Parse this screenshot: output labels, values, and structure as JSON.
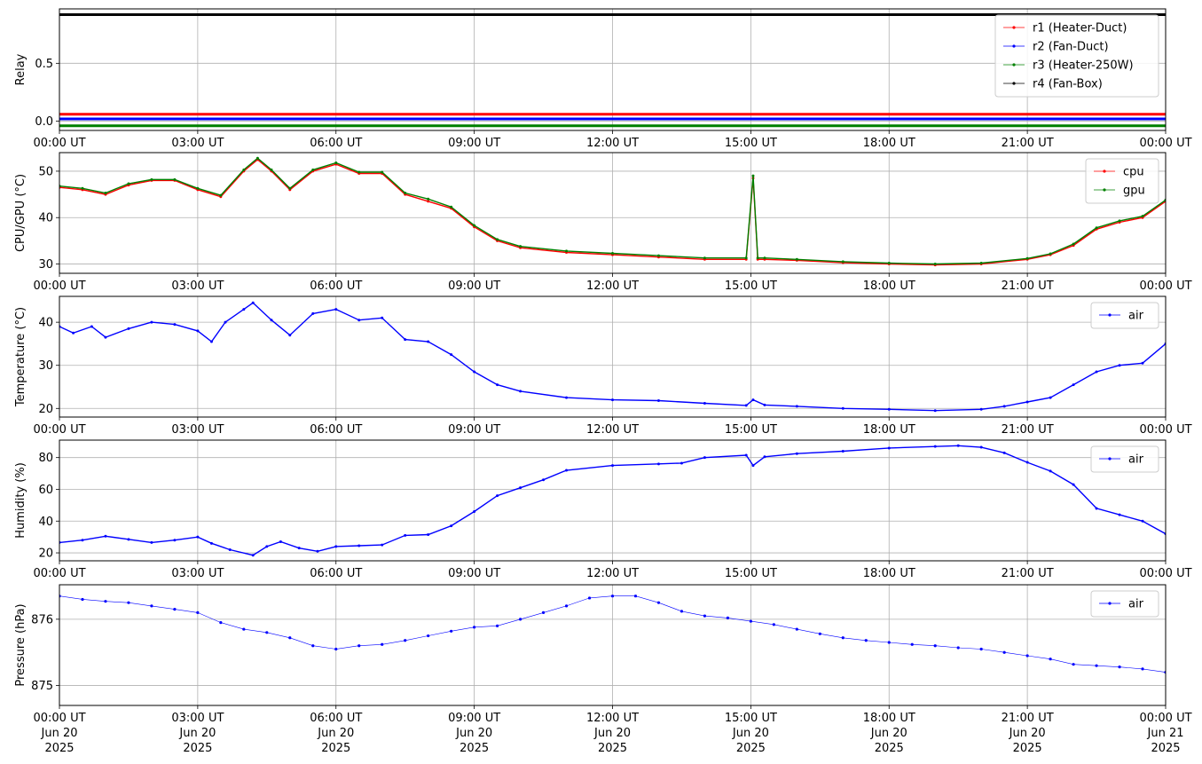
{
  "x_ticks": [
    "00:00 UT",
    "03:00 UT",
    "06:00 UT",
    "09:00 UT",
    "12:00 UT",
    "15:00 UT",
    "18:00 UT",
    "21:00 UT",
    "00:00 UT"
  ],
  "x_date_lines": [
    [
      "Jun 20",
      "2025"
    ],
    [
      "Jun 20",
      "2025"
    ],
    [
      "Jun 20",
      "2025"
    ],
    [
      "Jun 20",
      "2025"
    ],
    [
      "Jun 20",
      "2025"
    ],
    [
      "Jun 20",
      "2025"
    ],
    [
      "Jun 20",
      "2025"
    ],
    [
      "Jun 20",
      "2025"
    ],
    [
      "Jun 21",
      "2025"
    ]
  ],
  "chart_data": [
    {
      "type": "line",
      "ylabel": "Relay",
      "xlim": [
        0,
        24
      ],
      "ylim": [
        -0.08,
        0.97
      ],
      "yticks": [
        0.0,
        0.5
      ],
      "ytick_labels": [
        "0.0",
        "0.5"
      ],
      "grid": true,
      "legend_position": "top-right",
      "series": [
        {
          "name": "r1 (Heater-Duct)",
          "color": "#ff0000",
          "x": [
            0,
            24
          ],
          "y": [
            0.06,
            0.06
          ]
        },
        {
          "name": "r2 (Fan-Duct)",
          "color": "#0000ff",
          "x": [
            0,
            24
          ],
          "y": [
            0.02,
            0.02
          ]
        },
        {
          "name": "r3 (Heater-250W)",
          "color": "#008000",
          "x": [
            0,
            24
          ],
          "y": [
            -0.04,
            -0.04
          ]
        },
        {
          "name": "r4 (Fan-Box)",
          "color": "#000000",
          "x": [
            0,
            24
          ],
          "y": [
            0.92,
            0.92
          ]
        }
      ]
    },
    {
      "type": "line",
      "ylabel": "CPU/GPU (°C)",
      "xlim": [
        0,
        24
      ],
      "ylim": [
        28,
        54
      ],
      "yticks": [
        30,
        40,
        50
      ],
      "ytick_labels": [
        "30",
        "40",
        "50"
      ],
      "grid": true,
      "legend_position": "top-right",
      "series": [
        {
          "name": "cpu",
          "color": "#ff0000",
          "x": [
            0,
            0.5,
            1.0,
            1.5,
            2.0,
            2.5,
            3.0,
            3.5,
            4.0,
            4.3,
            4.6,
            5.0,
            5.5,
            6.0,
            6.5,
            7.0,
            7.5,
            8.0,
            8.5,
            9.0,
            9.5,
            10.0,
            11.0,
            12.0,
            13.0,
            14.0,
            14.9,
            15.05,
            15.15,
            15.3,
            16.0,
            17.0,
            18.0,
            19.0,
            20.0,
            21.0,
            21.5,
            22.0,
            22.5,
            23.0,
            23.5,
            24.0
          ],
          "y": [
            46.5,
            46.0,
            45.0,
            47.0,
            48.0,
            48.0,
            46.0,
            44.5,
            50.0,
            52.5,
            50.0,
            46.0,
            50.0,
            51.5,
            49.5,
            49.5,
            45.0,
            43.5,
            42.0,
            38.0,
            35.0,
            33.5,
            32.5,
            32.0,
            31.5,
            31.0,
            31.0,
            48.5,
            31.0,
            31.0,
            30.8,
            30.3,
            30.0,
            29.8,
            30.0,
            31.0,
            32.0,
            34.0,
            37.5,
            39.0,
            40.0,
            43.5
          ]
        },
        {
          "name": "gpu",
          "color": "#008000",
          "x": [
            0,
            0.5,
            1.0,
            1.5,
            2.0,
            2.5,
            3.0,
            3.5,
            4.0,
            4.3,
            4.6,
            5.0,
            5.5,
            6.0,
            6.5,
            7.0,
            7.5,
            8.0,
            8.5,
            9.0,
            9.5,
            10.0,
            11.0,
            12.0,
            13.0,
            14.0,
            14.9,
            15.05,
            15.15,
            15.3,
            16.0,
            17.0,
            18.0,
            19.0,
            20.0,
            21.0,
            21.5,
            22.0,
            22.5,
            23.0,
            23.5,
            24.0
          ],
          "y": [
            46.8,
            46.3,
            45.3,
            47.3,
            48.2,
            48.2,
            46.3,
            44.8,
            50.3,
            52.8,
            50.3,
            46.3,
            50.3,
            51.8,
            49.8,
            49.8,
            45.3,
            44.0,
            42.3,
            38.3,
            35.3,
            33.8,
            32.8,
            32.3,
            31.8,
            31.3,
            31.3,
            49.0,
            31.3,
            31.3,
            31.0,
            30.5,
            30.2,
            30.0,
            30.2,
            31.2,
            32.2,
            34.3,
            37.8,
            39.3,
            40.3,
            43.8
          ]
        }
      ]
    },
    {
      "type": "line",
      "ylabel": "Temperature (°C)",
      "xlim": [
        0,
        24
      ],
      "ylim": [
        18,
        46
      ],
      "yticks": [
        20,
        30,
        40
      ],
      "ytick_labels": [
        "20",
        "30",
        "40"
      ],
      "grid": true,
      "legend_position": "top-right",
      "series": [
        {
          "name": "air",
          "color": "#0000ff",
          "x": [
            0,
            0.3,
            0.7,
            1.0,
            1.5,
            2.0,
            2.5,
            3.0,
            3.3,
            3.6,
            4.0,
            4.2,
            4.6,
            5.0,
            5.5,
            6.0,
            6.5,
            7.0,
            7.5,
            8.0,
            8.5,
            9.0,
            9.5,
            10.0,
            11.0,
            12.0,
            13.0,
            14.0,
            14.9,
            15.05,
            15.3,
            16.0,
            17.0,
            18.0,
            19.0,
            20.0,
            20.5,
            21.0,
            21.5,
            22.0,
            22.5,
            23.0,
            23.5,
            24.0
          ],
          "y": [
            39.0,
            37.5,
            39.0,
            36.5,
            38.5,
            40.0,
            39.5,
            38.0,
            35.5,
            40.0,
            43.0,
            44.5,
            40.5,
            37.0,
            42.0,
            43.0,
            40.5,
            41.0,
            36.0,
            35.5,
            32.5,
            28.5,
            25.5,
            24.0,
            22.5,
            22.0,
            21.8,
            21.2,
            20.7,
            22.0,
            20.8,
            20.5,
            20.0,
            19.8,
            19.5,
            19.8,
            20.5,
            21.5,
            22.5,
            25.5,
            28.5,
            30.0,
            30.5,
            35.0
          ]
        }
      ]
    },
    {
      "type": "line",
      "ylabel": "Humidity (%)",
      "xlim": [
        0,
        24
      ],
      "ylim": [
        15,
        91
      ],
      "yticks": [
        20,
        40,
        60,
        80
      ],
      "ytick_labels": [
        "20",
        "40",
        "60",
        "80"
      ],
      "grid": true,
      "legend_position": "top-right",
      "series": [
        {
          "name": "air",
          "color": "#0000ff",
          "x": [
            0,
            0.5,
            1.0,
            1.5,
            2.0,
            2.5,
            3.0,
            3.3,
            3.7,
            4.2,
            4.5,
            4.8,
            5.2,
            5.6,
            6.0,
            6.5,
            7.0,
            7.5,
            8.0,
            8.5,
            9.0,
            9.5,
            10.0,
            10.5,
            11.0,
            12.0,
            13.0,
            13.5,
            14.0,
            14.9,
            15.05,
            15.3,
            16.0,
            17.0,
            18.0,
            19.0,
            19.5,
            20.0,
            20.5,
            21.0,
            21.5,
            22.0,
            22.5,
            23.0,
            23.5,
            24.0
          ],
          "y": [
            26.5,
            28.0,
            30.5,
            28.5,
            26.5,
            28.0,
            30.0,
            26.0,
            22.0,
            18.5,
            24.0,
            27.0,
            23.0,
            21.0,
            24.0,
            24.5,
            25.0,
            31.0,
            31.5,
            37.0,
            46.0,
            56.0,
            61.0,
            66.0,
            72.0,
            75.0,
            76.0,
            76.5,
            80.0,
            81.5,
            75.0,
            80.5,
            82.5,
            84.0,
            86.0,
            87.0,
            87.5,
            86.5,
            83.0,
            77.0,
            71.5,
            63.0,
            48.0,
            44.0,
            40.0,
            32.0
          ]
        }
      ]
    },
    {
      "type": "scatter",
      "ylabel": "Pressure (hPa)",
      "xlim": [
        0,
        24
      ],
      "ylim": [
        874.7,
        876.52
      ],
      "yticks": [
        875,
        876
      ],
      "ytick_labels": [
        "875",
        "876"
      ],
      "grid": true,
      "legend_position": "top-right",
      "series": [
        {
          "name": "air",
          "color": "#0000ff",
          "x": [
            0,
            0.5,
            1.0,
            1.5,
            2.0,
            2.5,
            3.0,
            3.5,
            4.0,
            4.5,
            5.0,
            5.5,
            6.0,
            6.5,
            7.0,
            7.5,
            8.0,
            8.5,
            9.0,
            9.5,
            10.0,
            10.5,
            11.0,
            11.5,
            12.0,
            12.5,
            13.0,
            13.5,
            14.0,
            14.5,
            15.0,
            15.5,
            16.0,
            16.5,
            17.0,
            17.5,
            18.0,
            18.5,
            19.0,
            19.5,
            20.0,
            20.5,
            21.0,
            21.5,
            22.0,
            22.5,
            23.0,
            23.5,
            24.0
          ],
          "y": [
            876.35,
            876.3,
            876.27,
            876.25,
            876.2,
            876.15,
            876.1,
            875.95,
            875.85,
            875.8,
            875.72,
            875.6,
            875.55,
            875.6,
            875.62,
            875.68,
            875.75,
            875.82,
            875.88,
            875.9,
            876.0,
            876.1,
            876.2,
            876.32,
            876.35,
            876.35,
            876.25,
            876.12,
            876.05,
            876.02,
            875.97,
            875.92,
            875.85,
            875.78,
            875.72,
            875.68,
            875.65,
            875.62,
            875.6,
            875.57,
            875.55,
            875.5,
            875.45,
            875.4,
            875.32,
            875.3,
            875.28,
            875.25,
            875.2
          ]
        }
      ]
    }
  ]
}
